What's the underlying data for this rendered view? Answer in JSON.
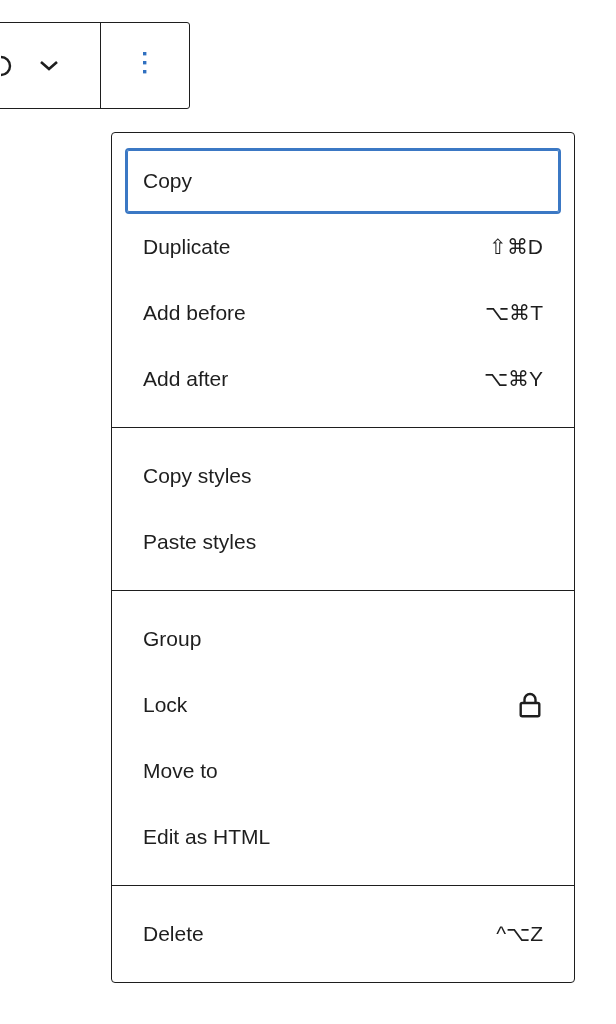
{
  "toolbar": {
    "more_button": {
      "selected": false
    }
  },
  "menu": {
    "groups": [
      {
        "items": [
          {
            "label": "Copy",
            "kind": "plain",
            "focused": true
          },
          {
            "label": "Duplicate",
            "kind": "shortcut",
            "shortcut": "⇧⌘D",
            "focused": false
          },
          {
            "label": "Add before",
            "kind": "shortcut",
            "shortcut": "⌥⌘T",
            "focused": false
          },
          {
            "label": "Add after",
            "kind": "shortcut",
            "shortcut": "⌥⌘Y",
            "focused": false
          }
        ]
      },
      {
        "items": [
          {
            "label": "Copy styles",
            "kind": "plain",
            "focused": false
          },
          {
            "label": "Paste styles",
            "kind": "plain",
            "focused": false
          }
        ]
      },
      {
        "items": [
          {
            "label": "Group",
            "kind": "plain",
            "focused": false
          },
          {
            "label": "Lock",
            "kind": "lock",
            "focused": false
          },
          {
            "label": "Move to",
            "kind": "plain",
            "focused": false
          },
          {
            "label": "Edit as HTML",
            "kind": "plain",
            "focused": false
          }
        ]
      },
      {
        "items": [
          {
            "label": "Delete",
            "kind": "shortcut",
            "shortcut": "^⌥Z",
            "focused": false
          }
        ]
      }
    ]
  }
}
